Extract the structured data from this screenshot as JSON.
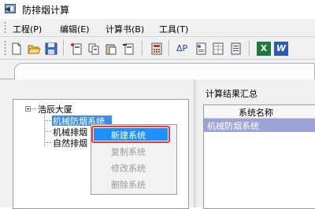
{
  "window": {
    "title": "防排烟计算"
  },
  "menu": [
    "工程(P)",
    "编辑(E)",
    "计算书(B)",
    "工具(T)"
  ],
  "toolbar": {
    "icons": [
      "new-file-icon",
      "open-folder-icon",
      "save-icon",
      "add-item-icon",
      "copy-item-icon",
      "paste-item-icon",
      "remove-item-icon",
      "calculator-icon",
      "delta-p-icon",
      "report-icon",
      "table-icon",
      "list-icon",
      "excel-icon",
      "word-icon"
    ],
    "delta_p_label": "ΔP",
    "excel_label": "X",
    "word_label": "W"
  },
  "tabs": {
    "left_arrow": "◀"
  },
  "tree": {
    "root": "浩辰大厦",
    "children": [
      "机械防烟系统",
      "机械排烟",
      "自然排烟"
    ]
  },
  "context_menu": {
    "items": [
      {
        "label": "新建系统",
        "enabled": true,
        "highlighted": true
      },
      {
        "label": "复制系统",
        "enabled": false
      },
      {
        "label": "修改系统",
        "enabled": false
      },
      {
        "label": "删除系统",
        "enabled": false
      }
    ]
  },
  "results": {
    "title": "计算结果汇总",
    "column_header": "系统名称",
    "rows": [
      "机械防烟系统"
    ]
  },
  "colors": {
    "highlight_border": "#e8393a",
    "menu_highlight": "#1e90ff",
    "row_selected": "#9da3d6"
  }
}
